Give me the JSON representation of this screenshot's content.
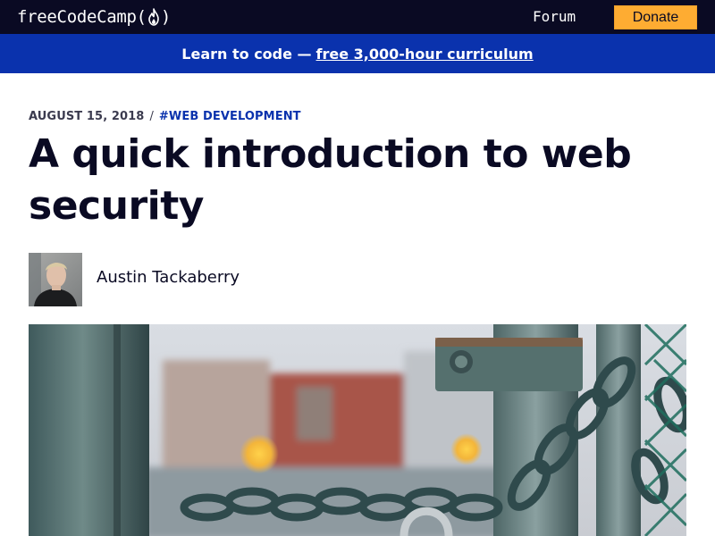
{
  "navbar": {
    "logo_text": "freeCodeCamp",
    "logo_icon": "flame-icon",
    "forum_label": "Forum",
    "donate_label": "Donate",
    "colors": {
      "background": "#0a0a23",
      "donate": "#feac32"
    }
  },
  "banner": {
    "prefix": "Learn to code —",
    "link_text": "free 3,000-hour curriculum",
    "color": "#0a32ad"
  },
  "article": {
    "date": "AUGUST 15, 2018",
    "separator": "/",
    "tag": "#WEB DEVELOPMENT",
    "title": "A quick introduction to web security",
    "author": {
      "name": "Austin Tackaberry"
    },
    "hero_image": "chains-and-padlock-photo"
  }
}
